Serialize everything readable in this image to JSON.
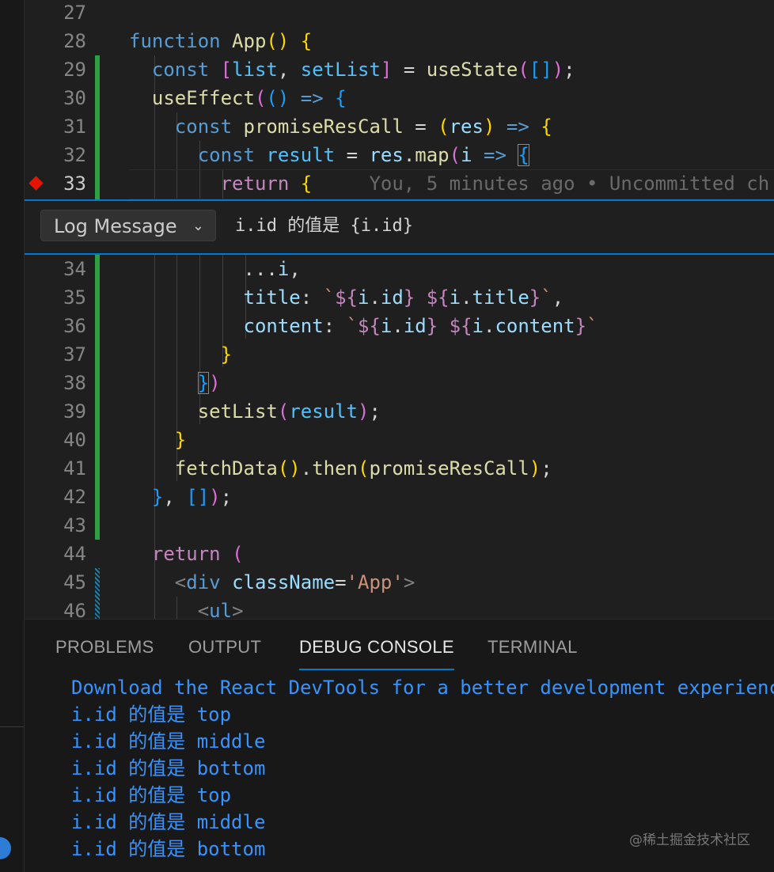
{
  "editor": {
    "line_numbers": [
      "27",
      "28",
      "29",
      "30",
      "31",
      "32",
      "33",
      "34",
      "35",
      "36",
      "37",
      "38",
      "39",
      "40",
      "41",
      "42",
      "43",
      "44",
      "45",
      "46"
    ],
    "blame": "You, 5 minutes ago • Uncommitted ch"
  },
  "log_widget": {
    "type_label": "Log Message",
    "expression": "i.id 的值是 {i.id}"
  },
  "panel": {
    "tabs": [
      "PROBLEMS",
      "OUTPUT",
      "DEBUG CONSOLE",
      "TERMINAL"
    ],
    "active_tab": "DEBUG CONSOLE",
    "console_lines": [
      "Download the React DevTools for a better development experienc",
      "i.id 的值是 top",
      "i.id 的值是 middle",
      "i.id 的值是 bottom",
      "i.id 的值是 top",
      "i.id 的值是 middle",
      "i.id 的值是 bottom"
    ]
  },
  "watermark": "@稀土掘金技术社区",
  "colors": {
    "accent": "#0078d4",
    "breakpoint": "#e51400",
    "gutter_added": "#2ea043",
    "console_text": "#3794ff"
  }
}
